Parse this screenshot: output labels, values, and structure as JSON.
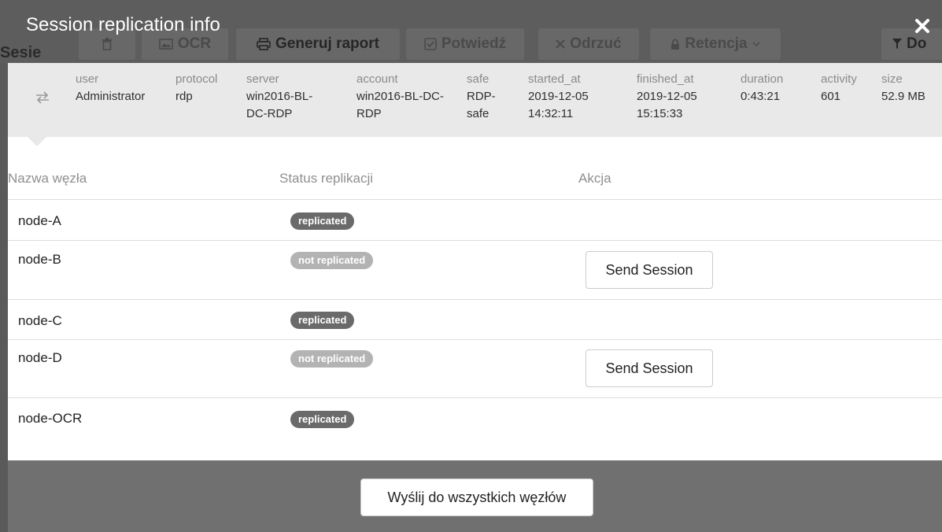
{
  "background": {
    "section_title": "Sesie",
    "toolbar": [
      {
        "label": "",
        "icon": "trash-icon"
      },
      {
        "label": "OCR",
        "icon": "image-icon"
      },
      {
        "label": "Generuj raport",
        "icon": "print-icon"
      },
      {
        "label": "Potwiedź",
        "icon": "check-square-icon"
      },
      {
        "label": "Odrzuć",
        "icon": "x-icon"
      },
      {
        "label": "Retencja",
        "icon": "lock-icon"
      },
      {
        "label": "Do",
        "icon": "filter-icon"
      }
    ]
  },
  "modal": {
    "title": "Session replication info",
    "session": {
      "user_label": "user",
      "user": "Administrator",
      "protocol_label": "protocol",
      "protocol": "rdp",
      "server_label": "server",
      "server": "win2016-BL-DC-RDP",
      "account_label": "account",
      "account": "win2016-BL-DC-RDP",
      "safe_label": "safe",
      "safe": "RDP-safe",
      "started_label": "started_at",
      "started_date": "2019-12-05",
      "started_time": "14:32:11",
      "finished_label": "finished_at",
      "finished_date": "2019-12-05",
      "finished_time": "15:15:33",
      "duration_label": "duration",
      "duration": "0:43:21",
      "activity_label": "activity",
      "activity": "601",
      "size_label": "size",
      "size": "52.9 MB"
    },
    "table": {
      "headers": [
        "Nazwa węzła",
        "Status replikacji",
        "Akcja"
      ],
      "rows": [
        {
          "node": "node-A",
          "status": "replicated",
          "action": ""
        },
        {
          "node": "node-B",
          "status": "not replicated",
          "action": "Send Session"
        },
        {
          "node": "node-C",
          "status": "replicated",
          "action": ""
        },
        {
          "node": "node-D",
          "status": "not replicated",
          "action": "Send Session"
        },
        {
          "node": "node-OCR",
          "status": "replicated",
          "action": ""
        }
      ]
    },
    "footer_button": "Wyślij do wszystkich węzłów"
  }
}
